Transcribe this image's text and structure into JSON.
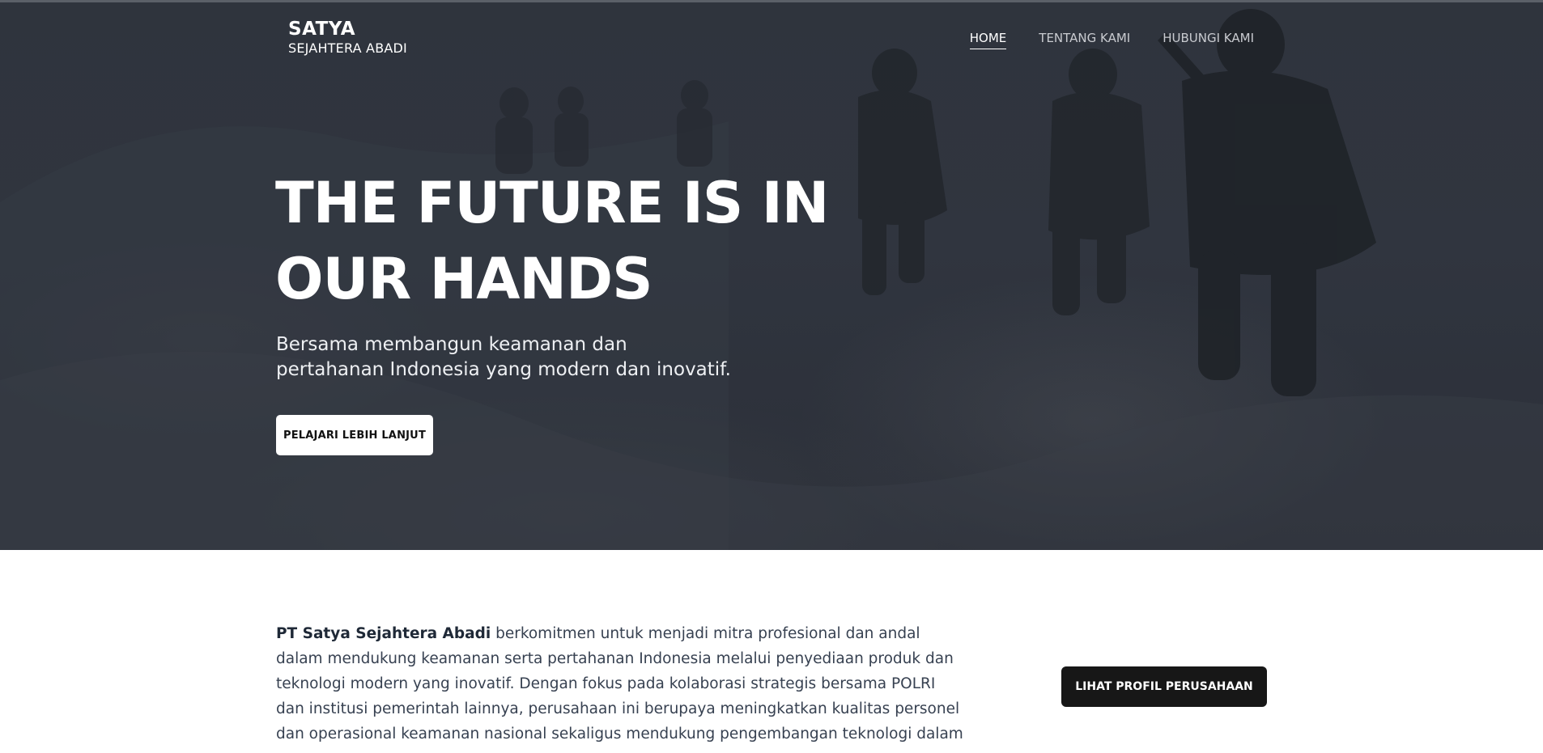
{
  "header": {
    "brand_name": "SATYA",
    "brand_sub": "SEJAHTERA ABADI",
    "nav": [
      {
        "label": "HOME",
        "active": true
      },
      {
        "label": "TENTANG KAMI",
        "active": false
      },
      {
        "label": "HUBUNGI KAMI",
        "active": false
      }
    ]
  },
  "hero": {
    "headline_line1": "THE FUTURE IS IN",
    "headline_line2": "OUR HANDS",
    "subtitle_line1": "Bersama membangun keamanan dan",
    "subtitle_line2": "pertahanan Indonesia yang modern dan inovatif.",
    "cta_label": "PELAJARI LEBIH LANJUT"
  },
  "about": {
    "company_name": "PT Satya Sejahtera Abadi",
    "description": " berkomitmen untuk menjadi mitra profesional dan andal dalam mendukung keamanan serta pertahanan Indonesia melalui penyediaan produk dan teknologi modern yang inovatif. Dengan fokus pada kolaborasi strategis bersama POLRI dan institusi pemerintah lainnya, perusahaan ini berupaya meningkatkan kualitas personel dan operasional keamanan nasional sekaligus mendukung pengembangan teknologi dalam",
    "profile_button_label": "LIHAT PROFIL PERUSAHAAN"
  },
  "colors": {
    "hero_overlay": "#30353f",
    "primary_dark": "#171717",
    "text_body": "#374151"
  }
}
